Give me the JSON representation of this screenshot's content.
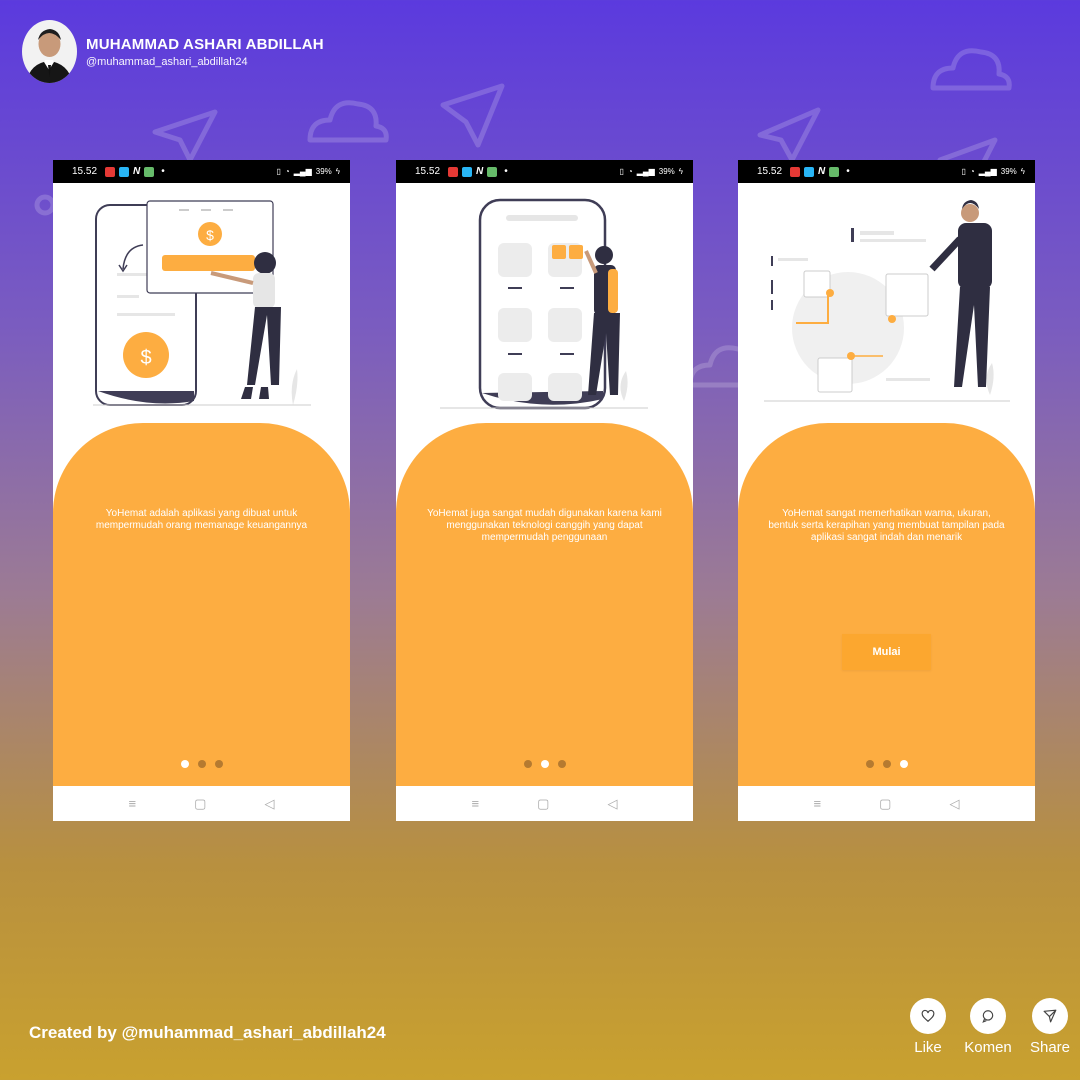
{
  "author": {
    "name": "MUHAMMAD ASHARI ABDILLAH",
    "handle": "@muhammad_ashari_abdillah24"
  },
  "screens": [
    {
      "status_time": "15.52",
      "status_battery": "39%",
      "caption": "YoHemat adalah aplikasi yang dibuat untuk mempermudah orang memanage keuangannya",
      "active_dot": 0
    },
    {
      "status_time": "15.52",
      "status_battery": "39%",
      "caption": "YoHemat juga sangat mudah digunakan karena kami menggunakan teknologi canggih yang dapat mempermudah penggunaan",
      "active_dot": 1
    },
    {
      "status_time": "15.52",
      "status_battery": "39%",
      "caption": "YoHemat sangat memerhatikan warna, ukuran, bentuk serta kerapihan yang membuat tampilan pada aplikasi sangat indah dan menarik",
      "active_dot": 2,
      "button_label": "Mulai"
    }
  ],
  "footer": {
    "credit": "Created by @muhammad_ashari_abdillah24",
    "like_label": "Like",
    "comment_label": "Komen",
    "share_label": "Share"
  },
  "colors": {
    "accent": "#fdad41",
    "button": "#fca72f",
    "dot_inactive": "#b57a30",
    "gradient_top": "#5b3ade",
    "gradient_bottom": "#c9a12f"
  },
  "icons": {
    "like": "heart-icon",
    "comment": "chat-bubble-icon",
    "share": "paper-plane-icon",
    "nav_menu": "menu-icon",
    "nav_home": "home-square-icon",
    "nav_back": "back-triangle-icon"
  }
}
